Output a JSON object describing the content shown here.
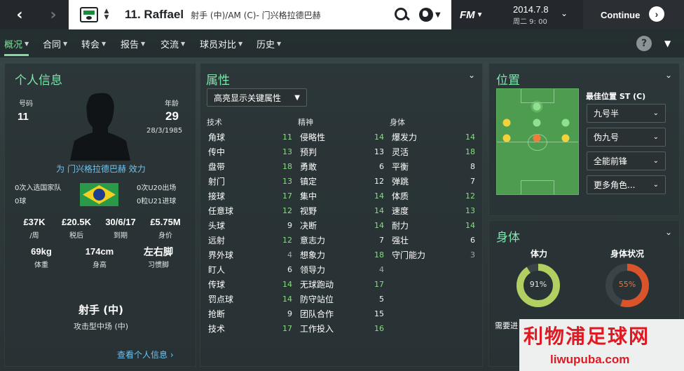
{
  "header": {
    "back_icon": "‹",
    "forward_icon": "›",
    "player_title": "11. Raffael",
    "position_line": "射手 (中)/AM (C)- 门兴格拉德巴赫",
    "fm_logo": "FM",
    "date": "2014.7.8",
    "day_time": "周二 9: 00",
    "continue_label": "Continue"
  },
  "tabs": [
    {
      "label": "概况",
      "active": true
    },
    {
      "label": "合同"
    },
    {
      "label": "转会"
    },
    {
      "label": "报告"
    },
    {
      "label": "交流"
    },
    {
      "label": "球员对比"
    },
    {
      "label": "历史"
    }
  ],
  "help_label": "?",
  "personal": {
    "title": "个人信息",
    "number_label": "号码",
    "number": "11",
    "age_label": "年龄",
    "age": "29",
    "birthdate": "28/3/1985",
    "club_link": "为 门兴格拉德巴赫 效力",
    "caps": "0次入选国家队",
    "goals": "0球",
    "u20_apps": "0次U20出场",
    "u21_goals": "0粒U21进球",
    "finance": [
      {
        "value": "£37K",
        "label": "/周"
      },
      {
        "value": "£20.5K",
        "label": "税后"
      },
      {
        "value": "30/6/17",
        "label": "到期"
      },
      {
        "value": "£5.75M",
        "label": "身价"
      }
    ],
    "body": [
      {
        "value": "69kg",
        "label": "体重"
      },
      {
        "value": "174cm",
        "label": "身高"
      },
      {
        "value": "左右脚",
        "label": "习惯脚"
      }
    ],
    "role": "射手 (中)",
    "role_sub": "攻击型中场 (中)",
    "view_profile": "查看个人信息 ›"
  },
  "attributes": {
    "title": "属性",
    "highlight_dropdown": "高亮显示关键属性",
    "col_technical": "技术",
    "col_mental": "精神",
    "col_physical": "身体",
    "technical": [
      {
        "name": "角球",
        "value": "11",
        "hl": "g"
      },
      {
        "name": "传中",
        "value": "13",
        "hl": "g"
      },
      {
        "name": "盘带",
        "value": "18",
        "hl": "g"
      },
      {
        "name": "射门",
        "value": "13",
        "hl": "g"
      },
      {
        "name": "接球",
        "value": "17",
        "hl": "g"
      },
      {
        "name": "任意球",
        "value": "12",
        "hl": "g"
      },
      {
        "name": "头球",
        "value": "9",
        "hl": "w"
      },
      {
        "name": "远射",
        "value": "12",
        "hl": "g"
      },
      {
        "name": "界外球",
        "value": "4",
        "hl": "d"
      },
      {
        "name": "盯人",
        "value": "6",
        "hl": "w"
      },
      {
        "name": "传球",
        "value": "14",
        "hl": "g"
      },
      {
        "name": "罚点球",
        "value": "14",
        "hl": "g"
      },
      {
        "name": "抢断",
        "value": "9",
        "hl": "w"
      },
      {
        "name": "技术",
        "value": "17",
        "hl": "g"
      }
    ],
    "mental": [
      {
        "name": "侵略性",
        "value": "14",
        "hl": "g"
      },
      {
        "name": "预判",
        "value": "13",
        "hl": "w"
      },
      {
        "name": "勇敢",
        "value": "6",
        "hl": "w"
      },
      {
        "name": "镇定",
        "value": "12",
        "hl": "w"
      },
      {
        "name": "集中",
        "value": "14",
        "hl": "g"
      },
      {
        "name": "视野",
        "value": "14",
        "hl": "g"
      },
      {
        "name": "决断",
        "value": "14",
        "hl": "g"
      },
      {
        "name": "意志力",
        "value": "7",
        "hl": "w"
      },
      {
        "name": "想象力",
        "value": "18",
        "hl": "g"
      },
      {
        "name": "领导力",
        "value": "4",
        "hl": "d"
      },
      {
        "name": "无球跑动",
        "value": "17",
        "hl": "g"
      },
      {
        "name": "防守站位",
        "value": "5",
        "hl": "w"
      },
      {
        "name": "团队合作",
        "value": "15",
        "hl": "w"
      },
      {
        "name": "工作投入",
        "value": "16",
        "hl": "g"
      }
    ],
    "physical": [
      {
        "name": "爆发力",
        "value": "14",
        "hl": "g"
      },
      {
        "name": "灵活",
        "value": "18",
        "hl": "g"
      },
      {
        "name": "平衡",
        "value": "8",
        "hl": "w"
      },
      {
        "name": "弹跳",
        "value": "7",
        "hl": "w"
      },
      {
        "name": "体质",
        "value": "12",
        "hl": "g"
      },
      {
        "name": "速度",
        "value": "13",
        "hl": "g"
      },
      {
        "name": "耐力",
        "value": "14",
        "hl": "g"
      },
      {
        "name": "强壮",
        "value": "6",
        "hl": "w"
      },
      {
        "name": "守门能力",
        "value": "3",
        "hl": "d"
      }
    ]
  },
  "position": {
    "title": "位置",
    "best_label": "最佳位置 ST (C)",
    "roles": [
      "九号半",
      "伪九号",
      "全能前锋",
      "更多角色..."
    ],
    "colors": {
      "natural": "#8fe08f",
      "accomplished": "#f2d23a",
      "best": "#f07b3a"
    }
  },
  "physical": {
    "title": "身体",
    "condition_label": "体力",
    "condition_value": "91%",
    "condition_fraction": 0.91,
    "fitness_label": "身体状况",
    "fitness_value": "55%",
    "fitness_fraction": 0.55,
    "needs_text": "需要进",
    "colors": {
      "condition": "#b2cf62",
      "fitness": "#d9542a"
    }
  },
  "watermark": {
    "top": "利物浦足球网",
    "bottom": "liwupuba.com"
  }
}
